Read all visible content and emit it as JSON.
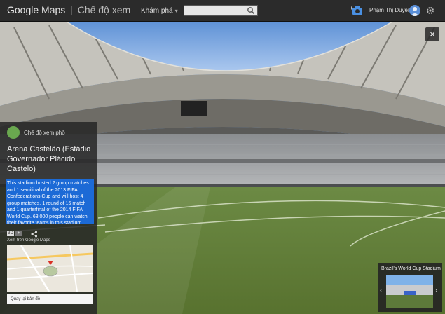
{
  "app": {
    "logo": "Google",
    "product": "Maps",
    "separator": "|",
    "mode": "Chế độ xem"
  },
  "header": {
    "explore_label": "Khám phá",
    "search_value": "",
    "search_placeholder": "",
    "user_name": "Phạm Thị Duyên"
  },
  "place": {
    "source_label": "Chế độ xem phố",
    "title": "Arena Castelão (Estádio Governador Plácido Castelo)",
    "description": "This stadium hosted 2 group matches and 1 semifinal of the 2013 FIFA Confederations Cup and will host 4 group matches, 1 round of 16 match and 1 quarterfinal of the 2014 FIFA World Cup. 63,000 people can watch their favorite teams in this stadium.",
    "map_label": "Xem trên Google Maps",
    "footer": "Quay lại bản đồ",
    "tool_1": "3D",
    "tool_2": "+"
  },
  "thumbnail": {
    "label": "Brazil's World Cup Stadiums"
  },
  "colors": {
    "topbar": "#2b2b2b",
    "panel": "#262626",
    "accent": "#1c6ad6",
    "grass": "#5f7a38"
  }
}
